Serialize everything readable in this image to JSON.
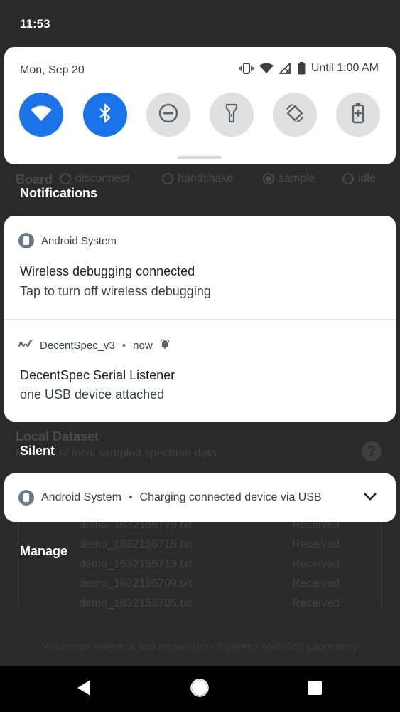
{
  "status_bar": {
    "time": "11:53"
  },
  "quick_settings": {
    "date": "Mon, Sep 20",
    "battery_text": "Until 1:00 AM",
    "tiles": [
      {
        "name": "wifi",
        "state": "on"
      },
      {
        "name": "bluetooth",
        "state": "on"
      },
      {
        "name": "do-not-disturb",
        "state": "off"
      },
      {
        "name": "flashlight",
        "state": "off"
      },
      {
        "name": "auto-rotate",
        "state": "off"
      },
      {
        "name": "battery-saver",
        "state": "off"
      }
    ],
    "accent_color": "#1a73e8"
  },
  "background_app": {
    "board_label": "Board",
    "radio_options": [
      "disconnect",
      "handshake",
      "sample",
      "idle"
    ],
    "selected_option": "sample",
    "local_dataset_title": "Local Dataset",
    "local_dataset_subtitle": "Preview of local sampled spectrum data",
    "help_icon": "?",
    "rows": [
      {
        "file": "demo_1632156779.txt",
        "status": "Received"
      },
      {
        "file": "demo_1632156715.txt",
        "status": "Received"
      },
      {
        "file": "demo_1632156713.txt",
        "status": "Received"
      },
      {
        "file": "demo_1632156709.txt",
        "status": "Received"
      },
      {
        "file": "demo_1632156705.txt",
        "status": "Received"
      }
    ],
    "footer": "Wisconsin Wireless and NetworkinG Systems (WiNGS) Laboratory"
  },
  "sections": {
    "notifications": "Notifications",
    "silent": "Silent",
    "manage": "Manage"
  },
  "notifications": [
    {
      "app": "Android System",
      "title": "Wireless debugging connected",
      "body": "Tap to turn off wireless debugging"
    },
    {
      "app": "DecentSpec_v3",
      "time": "now",
      "title": "DecentSpec Serial Listener",
      "body": "one USB device attached"
    }
  ],
  "silent_notification": {
    "app": "Android System",
    "text": "Charging connected device via USB"
  }
}
